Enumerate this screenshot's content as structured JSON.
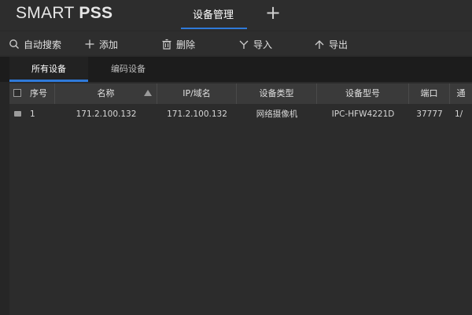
{
  "app": {
    "title_light": "SMART ",
    "title_bold": "PSS",
    "active_tab": "设备管理",
    "add_tab_symbol": "+"
  },
  "toolbar": {
    "auto_search": "自动搜索",
    "add": "添加",
    "delete": "删除",
    "import": "导入",
    "export": "导出"
  },
  "subtabs": {
    "all_devices": "所有设备",
    "encode_devices": "编码设备"
  },
  "table": {
    "headers": [
      "序号",
      "名称",
      "IP/域名",
      "设备类型",
      "设备型号",
      "端口",
      "通"
    ],
    "rows": [
      [
        "1",
        "171.2.100.132",
        "171.2.100.132",
        "网络摄像机",
        "IPC-HFW4221D",
        "37777",
        "1/"
      ]
    ]
  },
  "colors": {
    "accent": "#2f7ad9",
    "background": "#2b2b2b",
    "header": "#3a3a3a"
  }
}
